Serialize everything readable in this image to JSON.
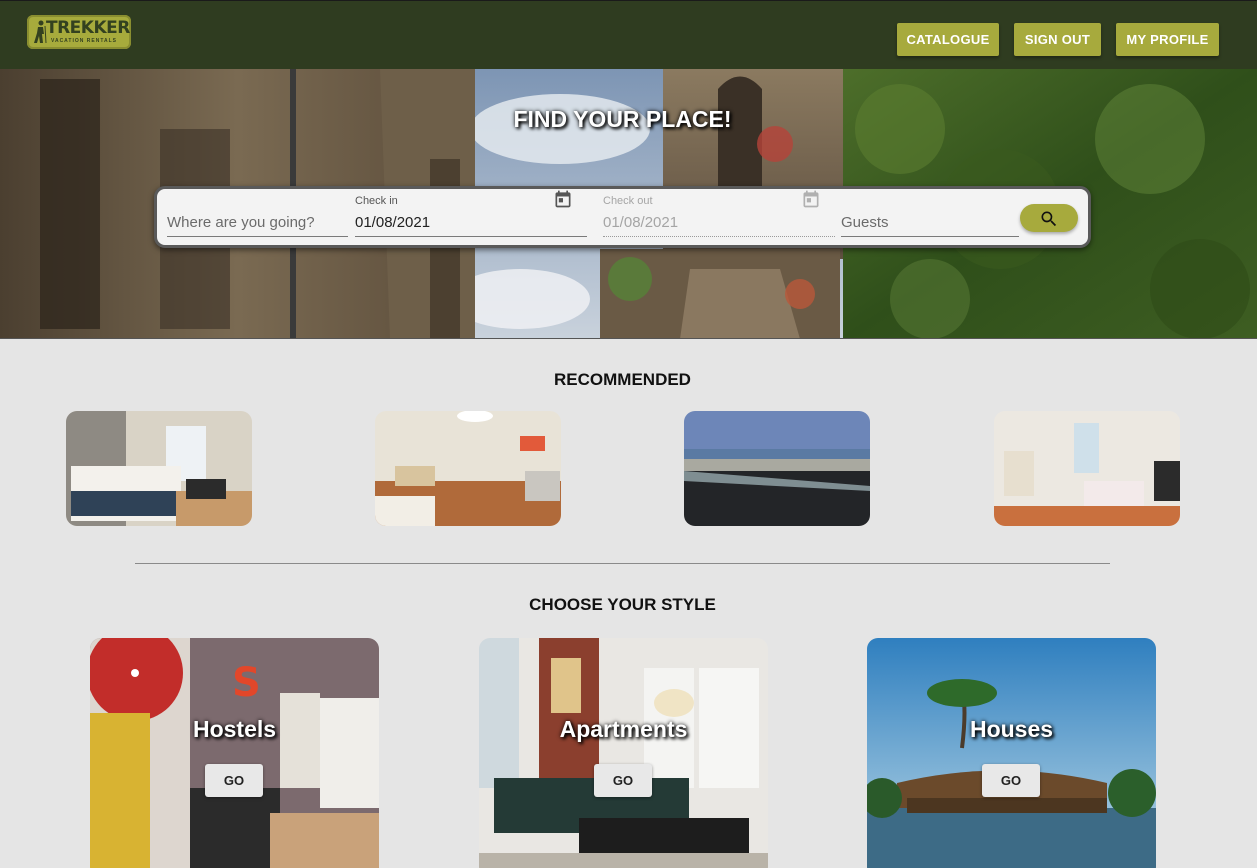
{
  "header": {
    "logo_text": "TREKKER",
    "logo_subtitle": "VACATION RENTALS",
    "nav": [
      {
        "label": "CATALOGUE"
      },
      {
        "label": "SIGN OUT"
      },
      {
        "label": "MY PROFILE"
      }
    ]
  },
  "hero": {
    "title": "FIND YOUR PLACE!",
    "search": {
      "destination_placeholder": "Where are you going?",
      "check_in_label": "Check in",
      "check_in_value": "01/08/2021",
      "check_out_label": "Check out",
      "check_out_value": "01/08/2021",
      "guests_placeholder": "Guests"
    }
  },
  "recommended": {
    "title": "RECOMMENDED"
  },
  "styles": {
    "title": "CHOOSE YOUR STYLE",
    "items": [
      {
        "name": "Hostels",
        "button": "GO"
      },
      {
        "name": "Apartments",
        "button": "GO"
      },
      {
        "name": "Houses",
        "button": "GO"
      }
    ]
  },
  "colors": {
    "header_bg": "#2f3c20",
    "accent": "#a7aa3d",
    "page_bg": "#e5e5e5"
  }
}
